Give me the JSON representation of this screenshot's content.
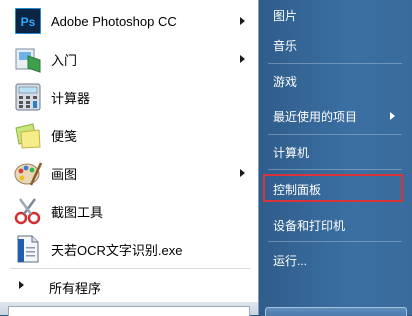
{
  "programs": [
    {
      "label": "Adobe Photoshop CC",
      "icon": "photoshop-icon",
      "icon_text": "Ps",
      "has_submenu": true
    },
    {
      "label": "入门",
      "icon": "getting-started-icon",
      "has_submenu": true
    },
    {
      "label": "计算器",
      "icon": "calculator-icon",
      "has_submenu": false
    },
    {
      "label": "便笺",
      "icon": "sticky-notes-icon",
      "has_submenu": false
    },
    {
      "label": "画图",
      "icon": "paint-icon",
      "has_submenu": true
    },
    {
      "label": "截图工具",
      "icon": "snipping-tool-icon",
      "has_submenu": false
    },
    {
      "label": "天若OCR文字识别.exe",
      "icon": "ocr-app-icon",
      "has_submenu": false
    }
  ],
  "all_programs_label": "所有程序",
  "right_items": [
    {
      "label": "图片",
      "has_submenu": false
    },
    {
      "label": "音乐",
      "has_submenu": false
    },
    {
      "label": "游戏",
      "has_submenu": false
    },
    {
      "label": "最近使用的项目",
      "has_submenu": true
    },
    {
      "label": "计算机",
      "has_submenu": false
    },
    {
      "label": "控制面板",
      "has_submenu": false,
      "highlighted": true
    },
    {
      "label": "设备和打印机",
      "has_submenu": false
    },
    {
      "label": "运行...",
      "has_submenu": false
    }
  ],
  "colors": {
    "right_pane": "#3b6fa2",
    "highlight_border": "#d9343a",
    "photoshop_bg": "#0b2545",
    "photoshop_text": "#31a8ff"
  }
}
